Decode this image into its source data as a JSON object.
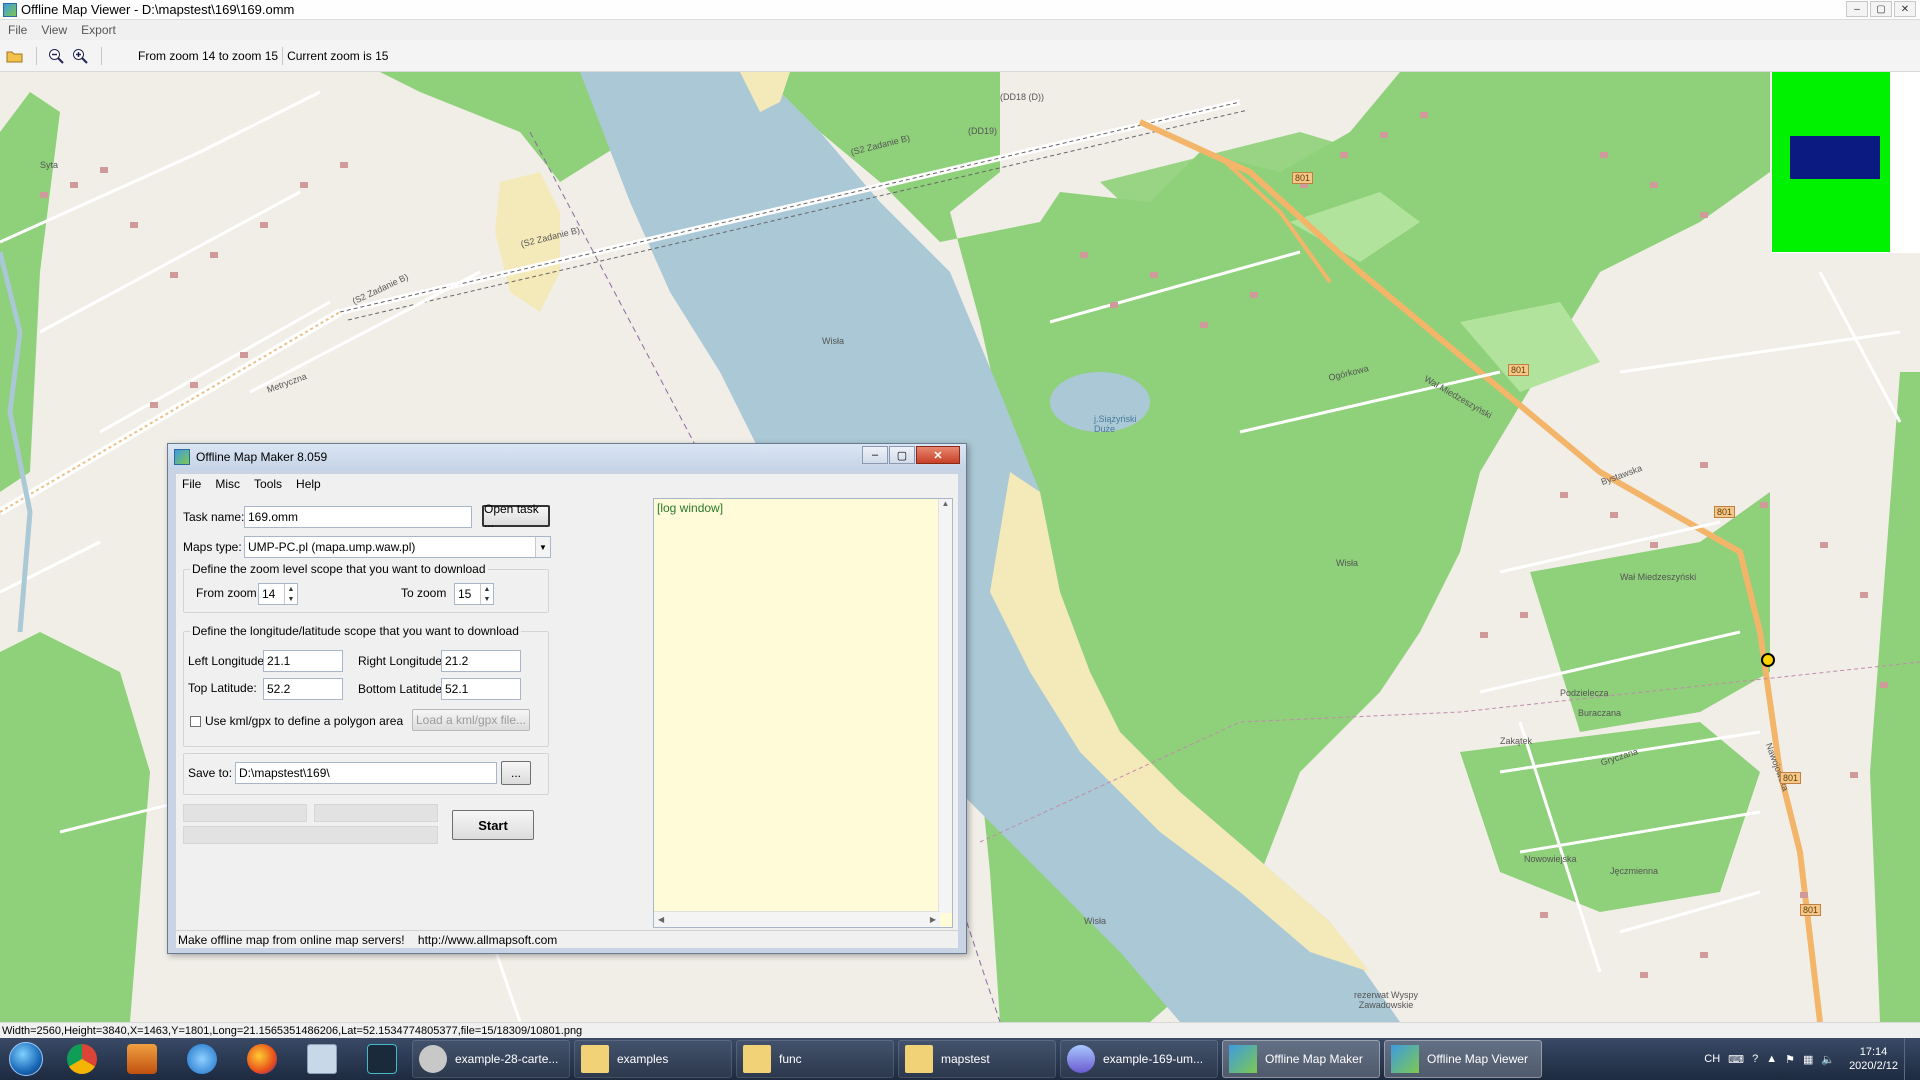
{
  "window": {
    "title": "Offline Map Viewer - D:\\mapstest\\169\\169.omm",
    "menu": [
      "File",
      "View",
      "Export"
    ],
    "zoom_range_text": "From zoom 14 to zoom 15",
    "current_zoom_text": "Current zoom is 15"
  },
  "map": {
    "labels": {
      "wisla1": "Wisła",
      "wisla2": "Wisła",
      "wisla3": "Wisła",
      "lake": "j.Siążyński Duże",
      "s2a": "(S2 Zadanie B)",
      "s2b": "(S2 Zadanie B)",
      "s2c": "(S2 Zadanie B)",
      "dd19": "(DD19)",
      "dd18": "(DD18 (D))",
      "wal": "Wał Miedzeszyński",
      "wal2": "Wał Miedzeszyński",
      "ogorkowa": "Ogórkowa",
      "bystawska": "Bystawska",
      "nawojowska": "Nawojowska",
      "podzieleczna": "Podzielecza",
      "buraczana": "Buraczana",
      "gryczana": "Gryczana",
      "zakatek": "Zakątek",
      "nowowiejska": "Nowowiejska",
      "jeczmienna": "Jęczmienna",
      "metryczna": "Metryczna",
      "syta": "Syta",
      "rezerwat": "rezerwat Wyspy Zawadowskie",
      "route801": "801"
    }
  },
  "overview": {
    "green": "#00f200",
    "navy": "#0a1a80"
  },
  "dialog": {
    "title": "Offline Map Maker 8.059",
    "menu": [
      "File",
      "Misc",
      "Tools",
      "Help"
    ],
    "task_name_label": "Task name:",
    "task_name_value": "169.omm",
    "open_task": "Open task ...",
    "maps_type_label": "Maps type:",
    "maps_type_value": "UMP-PC.pl (mapa.ump.waw.pl)",
    "zoom_group": "Define the zoom level scope that you want to download",
    "from_zoom_label": "From zoom",
    "from_zoom_value": "14",
    "to_zoom_label": "To zoom",
    "to_zoom_value": "15",
    "lonlat_group": "Define the longitude/latitude scope that you want to download",
    "left_lon_label": "Left Longitude:",
    "left_lon_value": "21.1",
    "right_lon_label": "Right Longitude:",
    "right_lon_value": "21.2",
    "top_lat_label": "Top Latitude:",
    "top_lat_value": "52.2",
    "bottom_lat_label": "Bottom Latitude:",
    "bottom_lat_value": "52.1",
    "kml_label": "Use kml/gpx to define a polygon area",
    "kml_checked": false,
    "load_kml": "Load a kml/gpx file...",
    "save_to_label": "Save to:",
    "save_to_value": "D:\\mapstest\\169\\",
    "browse": "...",
    "start": "Start",
    "log": "[log window]",
    "status_left": "Make offline map from online map servers!",
    "status_right": "http://www.allmapsoft.com"
  },
  "status_bar": "Width=2560,Height=3840,X=1463,Y=1801,Long=21.1565351486206,Lat=52.1534774805377,file=15/18309/10801.png",
  "taskbar": {
    "tasks": [
      {
        "label": "example-28-carte...",
        "active": false
      },
      {
        "label": "examples",
        "active": false
      },
      {
        "label": "func",
        "active": false
      },
      {
        "label": "mapstest",
        "active": false
      },
      {
        "label": "example-169-um...",
        "active": false
      },
      {
        "label": "Offline Map Maker",
        "active": true
      },
      {
        "label": "Offline Map Viewer",
        "active": true
      }
    ],
    "lang": "CH",
    "time": "17:14",
    "date": "2020/2/12"
  }
}
